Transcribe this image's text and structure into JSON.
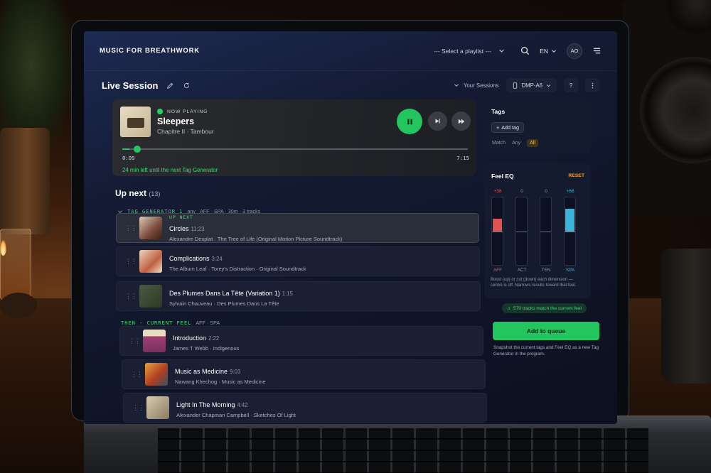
{
  "header": {
    "brand": "MUSIC FOR BREATHWORK",
    "playlist_select": "--- Select a playlist ---",
    "language": "EN",
    "avatar_initials": "AO"
  },
  "session": {
    "title": "Live Session",
    "your_sessions": "Your Sessions",
    "device": "DMP-A6",
    "help": "?"
  },
  "now_playing": {
    "label": "NOW PLAYING",
    "title": "Sleepers",
    "subtitle": "Chapitre II · Tambour",
    "elapsed": "0:09",
    "total": "7:15",
    "progress": 0.02,
    "remaining_note": "24 min left until the next Tag Generator"
  },
  "up_next": {
    "title": "Up next",
    "count": "(13)",
    "groups": [
      {
        "tag": "TAG GENERATOR 1",
        "meta": "any · AFF · SPA · 30m · 3 tracks",
        "tracks": [
          {
            "flag": "UP NEXT",
            "title": "Circles",
            "duration": "11:23",
            "meta": "Alexandre Desplat · The Tree of Life (Original Motion Picture Soundtrack)"
          },
          {
            "flag": "",
            "title": "Complications",
            "duration": "3:24",
            "meta": "The Album Leaf · Torey's Distraction · Original Soundtrack"
          },
          {
            "flag": "",
            "title": "Des Plumes Dans La Tête (Variation 1)",
            "duration": "1:15",
            "meta": "Sylvain Chauveau · Des Plumes Dans La Tête"
          }
        ]
      },
      {
        "tag": "THEN · CURRENT FEEL",
        "meta": "AFF · SPA",
        "tracks": [
          {
            "flag": "",
            "title": "Introduction",
            "duration": "2:22",
            "meta": "James T Webb · Indigenous"
          },
          {
            "flag": "",
            "title": "Music as Medicine",
            "duration": "9:03",
            "meta": "Nawang Khechog · Music as Medicine"
          },
          {
            "flag": "",
            "title": "Light In The Morning",
            "duration": "4:42",
            "meta": "Alexander Chapman Campbell · Sketches Of Light"
          }
        ]
      }
    ]
  },
  "tags_panel": {
    "title": "Tags",
    "add_tag": "Add tag",
    "match_label": "Match",
    "match_any": "Any",
    "match_all": "All"
  },
  "feel_eq": {
    "title": "Feel EQ",
    "reset": "RESET",
    "bands": [
      {
        "label": "AFF",
        "value": "+38",
        "level": 0.38,
        "color": "#e05252"
      },
      {
        "label": "ACT",
        "value": "0",
        "level": 0,
        "color": "#6a7286"
      },
      {
        "label": "TEN",
        "value": "0",
        "level": 0,
        "color": "#6a7286"
      },
      {
        "label": "SPA",
        "value": "+66",
        "level": 0.66,
        "color": "#3ab4d8"
      }
    ],
    "help": "Boost (up) or cut (down) each dimension — centre is off. Narrows results toward that feel."
  },
  "match_chip": "579 tracks match the current feel",
  "add_queue": "Add to queue",
  "snapshot_text": "Snapshot the current tags and Feel EQ as a new Tag Generator in the program.",
  "colors": {
    "accent_green": "#22c55e",
    "reset_orange": "#f0a030",
    "aff_red": "#e05252",
    "spa_blue": "#3ab4d8"
  }
}
